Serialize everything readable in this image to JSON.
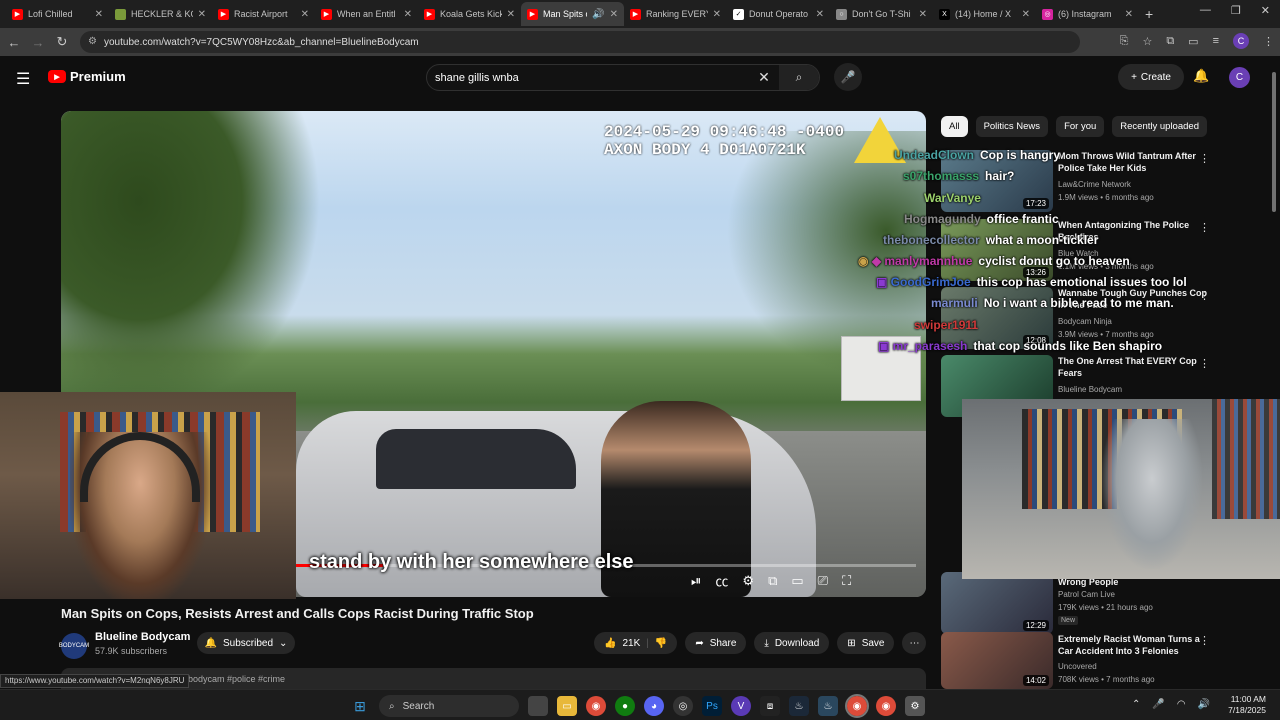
{
  "browser": {
    "tabs": [
      {
        "title": "Lofi Chilled",
        "favicon_color": "#ff0000",
        "active": false
      },
      {
        "title": "HECKLER & KO",
        "favicon_color": "#7a9a3a",
        "active": false
      },
      {
        "title": "Racist Airport",
        "favicon_color": "#ff0000",
        "active": false
      },
      {
        "title": "When an Entitl",
        "favicon_color": "#ff0000",
        "active": false
      },
      {
        "title": "Koala Gets Kick",
        "favicon_color": "#ff0000",
        "active": false
      },
      {
        "title": "Man Spits o",
        "favicon_color": "#ff0000",
        "active": true
      },
      {
        "title": "Ranking EVERY",
        "favicon_color": "#ff0000",
        "active": false
      },
      {
        "title": "Donut Operato",
        "favicon_color": "#ffffff",
        "active": false
      },
      {
        "title": "Don't Go T-Shi",
        "favicon_color": "#888888",
        "active": false
      },
      {
        "title": "(14) Home / X",
        "favicon_color": "#000000",
        "active": false
      },
      {
        "title": "(6) Instagram",
        "favicon_color": "#d6249f",
        "active": false
      }
    ],
    "url": "youtube.com/watch?v=7QC5WY08Hzc&ab_channel=BluelineBodycam",
    "profile_letter": "C",
    "status_url": "https://www.youtube.com/watch?v=M2nqN6y8JRU"
  },
  "header": {
    "brand": "Premium",
    "search_query": "shane gillis wnba",
    "create_label": "Create",
    "avatar_letter": "C"
  },
  "video": {
    "timestamp_line1": "2024-05-29 09:46:48 -0400",
    "timestamp_line2": "AXON BODY 4 D01A0721K",
    "caption": "stand by with her somewhere else",
    "progress_fraction": 0.14,
    "title": "Man Spits on Cops, Resists Arrest and Calls Cops Racist During Traffic Stop",
    "channel": "Blueline Bodycam",
    "channel_avatar_text": "BODYCAM",
    "subscribers": "57.9K subscribers",
    "subscribe_label": "Subscribed",
    "likes": "21K",
    "share_label": "Share",
    "download_label": "Download",
    "save_label": "Save",
    "description_tags": "bodycam #police #crime"
  },
  "chips": [
    "All",
    "Politics News",
    "For you",
    "Recently uploaded"
  ],
  "recommendations": [
    {
      "title": "Mom Throws Wild Tantrum After Police Take Her Kids",
      "channel": "Law&Crime Network",
      "meta": "1.9M views • 6 months ago",
      "duration": "17:23"
    },
    {
      "title": "When Antagonizing The Police Backfires",
      "channel": "Blue Watch",
      "meta": "1.1M views • 3 months ago",
      "duration": "13:26"
    },
    {
      "title": "Wannabe Tough Guy Punches Cop In The Face",
      "channel": "Bodycam Ninja",
      "meta": "3.9M views • 7 months ago",
      "duration": "12:08"
    },
    {
      "title": "The One Arrest That EVERY Cop Fears",
      "channel": "Blueline Bodycam",
      "meta": "",
      "duration": ""
    },
    {
      "title": "Wrong People",
      "channel": "Patrol Cam Live",
      "meta": "179K views • 21 hours ago",
      "duration": "12:29",
      "badge": "New"
    },
    {
      "title": "Extremely Racist Woman Turns a Car Accident Into 3 Felonies",
      "channel": "Uncovered",
      "meta": "708K views • 7 months ago",
      "duration": "14:02"
    }
  ],
  "chat": [
    {
      "user": "UndeadClown",
      "msg": "Cop is hangry",
      "color": "#4aa3a3"
    },
    {
      "user": "s07thomasss",
      "msg": "hair?",
      "color": "#3aa36a"
    },
    {
      "user": "WarVanye",
      "msg": "",
      "color": "#9bd06b"
    },
    {
      "user": "Hogmagundy",
      "msg": "office frantic",
      "color": "#8a8a8a"
    },
    {
      "user": "thebonecollector",
      "msg": "what a moon-tickler",
      "color": "#7a8aa8"
    },
    {
      "user": "manlymannhue",
      "msg": "cyclist donut go to heaven",
      "color": "#c03aa8"
    },
    {
      "user": "GoodGrimJoe",
      "msg": "this cop has emotional issues too lol",
      "color": "#3a6ad0"
    },
    {
      "user": "marmuli",
      "msg": "No i want a bible read to me man.",
      "color": "#7a8ad0"
    },
    {
      "user": "swiper1911",
      "msg": "",
      "color": "#d03a3a"
    },
    {
      "user": "mr_parasesh",
      "msg": "that cop sounds like Ben shapiro",
      "color": "#8a3ad0"
    }
  ],
  "taskbar": {
    "search_label": "Search",
    "time": "11:00 AM",
    "date": "7/18/2025"
  },
  "colors": {
    "youtube_red": "#ff0000",
    "background": "#0f0f0f",
    "chip_bg": "#272727"
  }
}
